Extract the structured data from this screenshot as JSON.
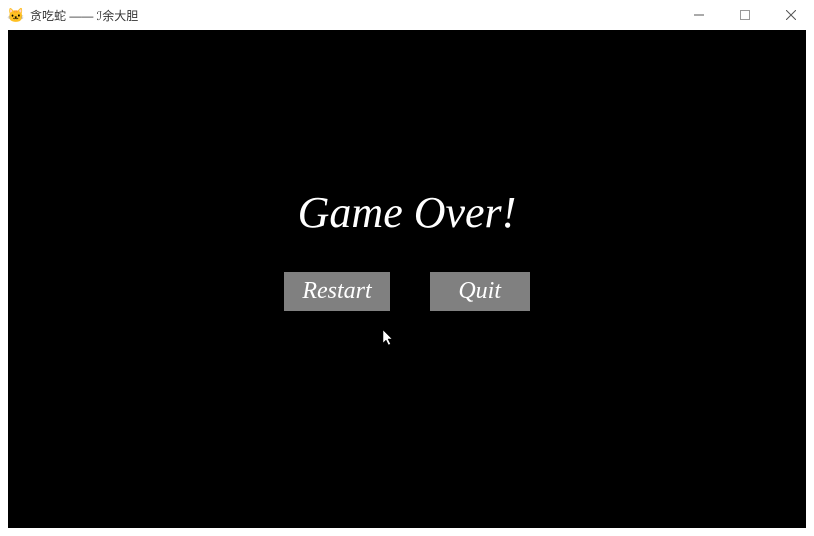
{
  "window": {
    "title": "贪吃蛇 —— ℐ余大胆",
    "icon": "🐱"
  },
  "game": {
    "message": "Game Over!",
    "buttons": {
      "restart": "Restart",
      "quit": "Quit"
    }
  }
}
